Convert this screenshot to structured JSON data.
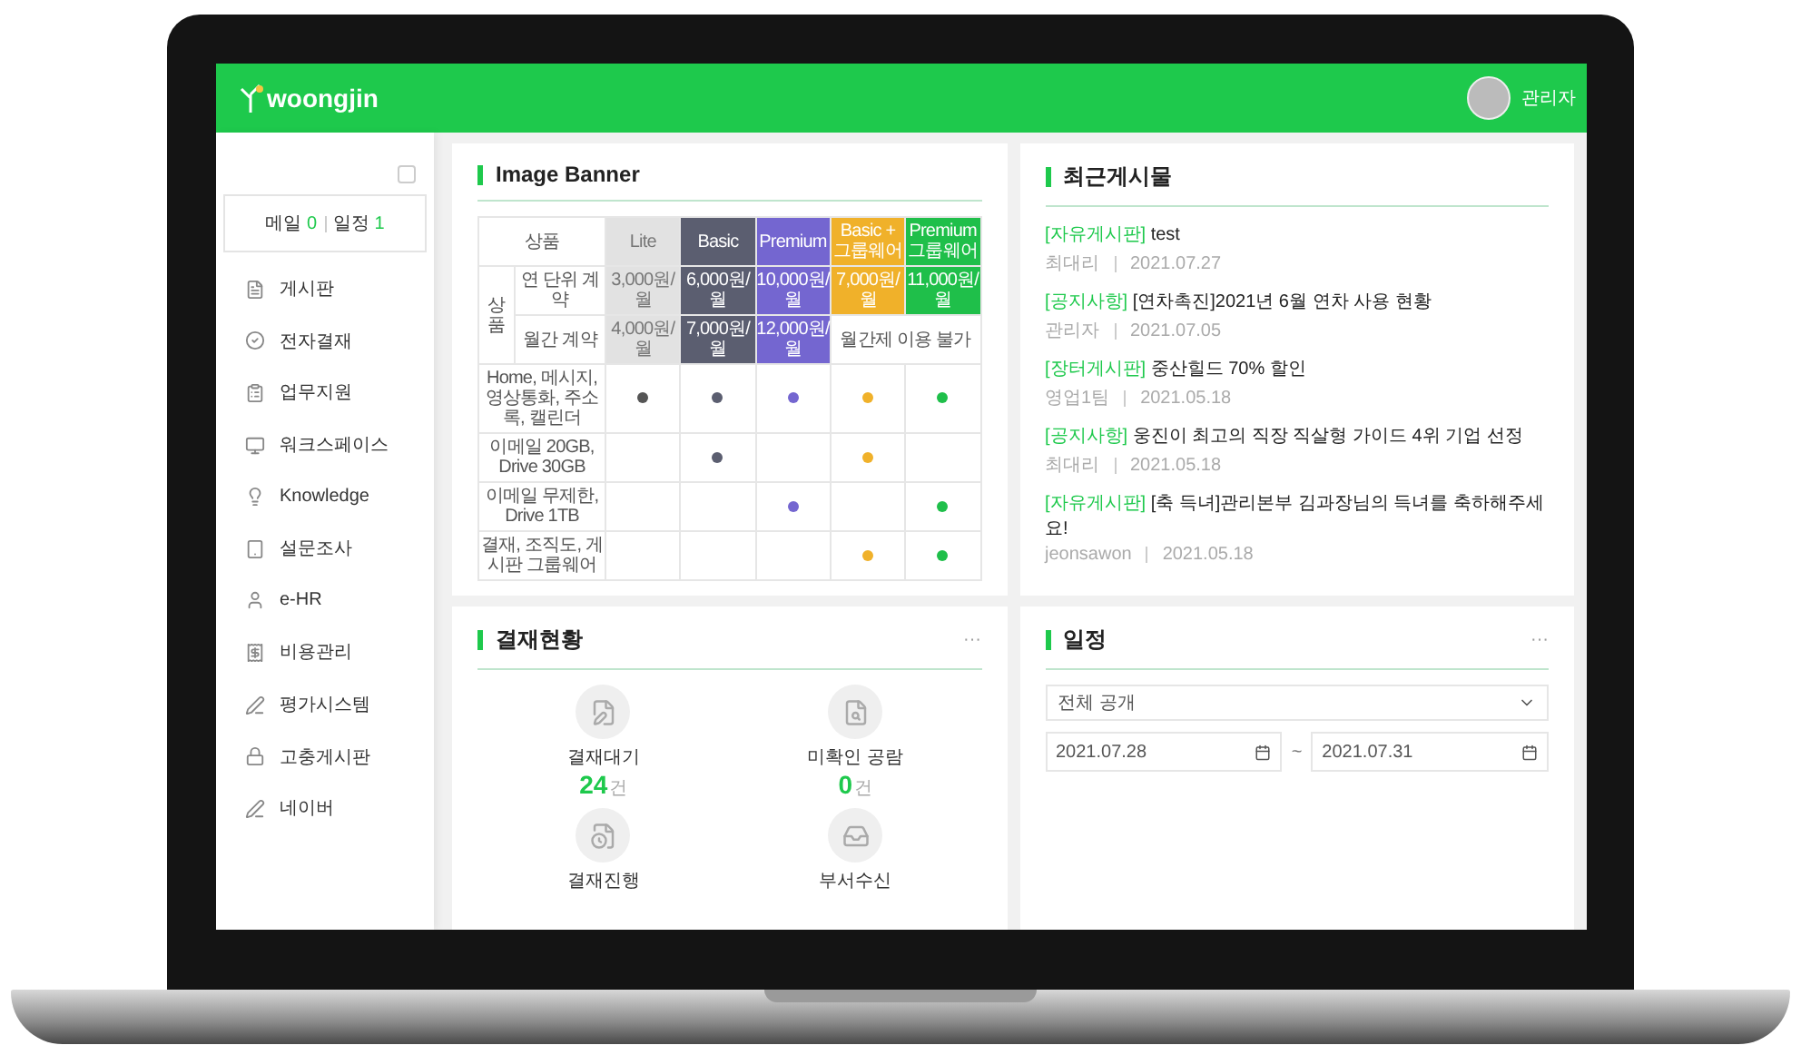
{
  "header": {
    "logo": "woongjin",
    "user_name": "관리자"
  },
  "sidebar": {
    "summary": [
      {
        "label": "메일",
        "count": "0"
      },
      {
        "label": "일정",
        "count": "1"
      }
    ],
    "menu": [
      {
        "label": "게시판",
        "kind": "board"
      },
      {
        "label": "전자결재",
        "kind": "check"
      },
      {
        "label": "업무지원",
        "kind": "list"
      },
      {
        "label": "워크스페이스",
        "kind": "monitor"
      },
      {
        "label": "Knowledge",
        "kind": "bulb"
      },
      {
        "label": "설문조사",
        "kind": "tablet"
      },
      {
        "label": "e-HR",
        "kind": "user"
      },
      {
        "label": "비용관리",
        "kind": "receipt"
      },
      {
        "label": "평가시스템",
        "kind": "pen"
      },
      {
        "label": "고충게시판",
        "kind": "lock"
      },
      {
        "label": "네이버",
        "kind": "pen"
      }
    ]
  },
  "banner": {
    "title": "Image Banner",
    "table": {
      "corner": "상품",
      "group_label": "상품",
      "annual_label": "연 단위 계약",
      "monthly_label": "월간 계약",
      "monthly_unavailable": "월간제 이용 불가",
      "plans": [
        {
          "name": "Lite",
          "kind": "light",
          "color": "#555555",
          "annual": "3,000원/월",
          "monthly": "4,000원/월"
        },
        {
          "name": "Basic",
          "kind": "solid",
          "color": "#5b5e70",
          "annual": "6,000원/월",
          "monthly": "7,000원/월"
        },
        {
          "name": "Premium",
          "kind": "solid",
          "color": "#7466d0",
          "annual": "10,000원/월",
          "monthly": "12,000원/월"
        },
        {
          "name": "Basic + 그룹웨어",
          "kind": "solid",
          "color": "#f0b12a",
          "annual": "7,000원/월"
        },
        {
          "name": "Premium 그룹웨어",
          "kind": "solid",
          "color": "#1fbf4a",
          "annual": "11,000원/월"
        }
      ],
      "features": [
        {
          "text": "Home, 메시지, 영상통화, 주소록, 캘린더",
          "marks": [
            true,
            true,
            true,
            true,
            true
          ]
        },
        {
          "text": "이메일 20GB, Drive 30GB",
          "marks": [
            false,
            true,
            false,
            true,
            false
          ]
        },
        {
          "text": "이메일 무제한, Drive 1TB",
          "marks": [
            false,
            false,
            true,
            false,
            true
          ]
        },
        {
          "text": "결재, 조직도, 게시판 그룹웨어",
          "marks": [
            false,
            false,
            false,
            true,
            true
          ]
        }
      ]
    }
  },
  "recent_posts": {
    "title": "최근게시물",
    "posts": [
      {
        "category": "[자유게시판]",
        "title": "test",
        "author": "최대리",
        "date": "2021.07.27"
      },
      {
        "category": "[공지사항]",
        "title": "[연차촉진]2021년 6월 연차 사용 현황",
        "author": "관리자",
        "date": "2021.07.05"
      },
      {
        "category": "[장터게시판]",
        "title": "중산힐드 70% 할인",
        "author": "영업1팀",
        "date": "2021.05.18"
      },
      {
        "category": "[공지사항]",
        "title": "웅진이 최고의 직장 직살형 가이드 4위 기업 선정",
        "author": "최대리",
        "date": "2021.05.18"
      },
      {
        "category": "[자유게시판]",
        "title": "[축 득녀]관리본부 김과장님의 득녀를 축하해주세요!",
        "author": "jeonsawon",
        "date": "2021.05.18"
      }
    ]
  },
  "approval": {
    "title": "결재현황",
    "more": "···",
    "items": [
      {
        "kind": "edit",
        "label": "결재대기",
        "count": "24",
        "unit": "건"
      },
      {
        "kind": "search",
        "label": "미확인 공람",
        "count": "0",
        "unit": "건"
      },
      {
        "kind": "progress",
        "label": "결재진행"
      },
      {
        "kind": "inbox",
        "label": "부서수신"
      }
    ]
  },
  "schedule": {
    "title": "일정",
    "more": "···",
    "visibility": "전체 공개",
    "start_date": "2021.07.28",
    "separator": "~",
    "end_date": "2021.07.31"
  }
}
